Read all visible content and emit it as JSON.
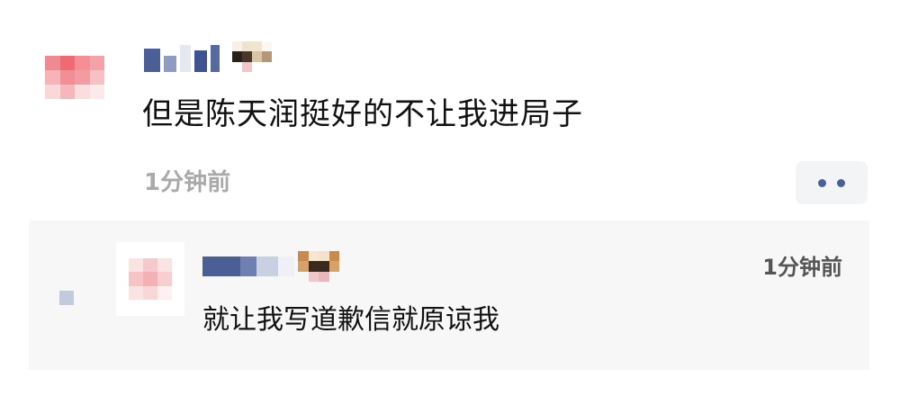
{
  "comment": {
    "text": "但是陈天润挺好的不让我进局子",
    "time": "1分钟前",
    "more_icon": "more-dots-icon",
    "avatar": "pixelated-avatar",
    "name_emoji": "pixelated-emoji"
  },
  "reply": {
    "text": "就让我写道歉信就原谅我",
    "time": "1分钟前",
    "avatar": "pixelated-avatar",
    "name_emoji": "dog-emoji"
  },
  "colors": {
    "name_blue": "#4b5f96",
    "more_dots": "#4a5f9a",
    "time_gray": "#a9a9a9",
    "reply_bg": "#f7f7f8"
  }
}
